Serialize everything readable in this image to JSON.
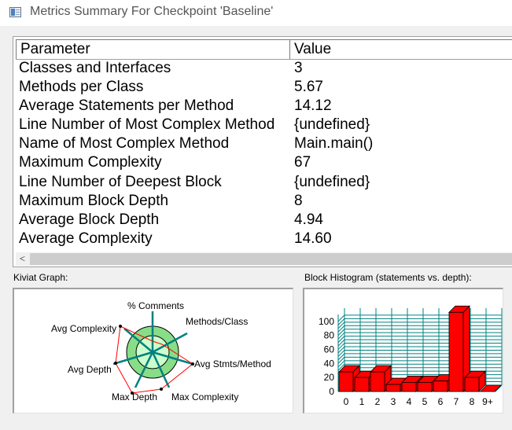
{
  "window": {
    "title": "Metrics Summary For Checkpoint 'Baseline'"
  },
  "table": {
    "headers": {
      "parameter": "Parameter",
      "value": "Value"
    },
    "rows": [
      {
        "parameter": "Classes and Interfaces",
        "value": "3"
      },
      {
        "parameter": "Methods per Class",
        "value": "5.67"
      },
      {
        "parameter": "Average Statements per Method",
        "value": "14.12"
      },
      {
        "parameter": "Line Number of Most Complex Method",
        "value": "{undefined}"
      },
      {
        "parameter": "Name of Most Complex Method",
        "value": "Main.main()"
      },
      {
        "parameter": "Maximum Complexity",
        "value": "67"
      },
      {
        "parameter": "Line Number of Deepest Block",
        "value": "{undefined}"
      },
      {
        "parameter": "Maximum Block Depth",
        "value": "8"
      },
      {
        "parameter": "Average Block Depth",
        "value": "4.94"
      },
      {
        "parameter": "Average Complexity",
        "value": "14.60"
      }
    ]
  },
  "scrollbar": {
    "left_arrow": "<"
  },
  "kiviat": {
    "label": "Kiviat Graph:",
    "axes": {
      "comments": "% Comments",
      "methods_class": "Methods/Class",
      "avg_stmts": "Avg Stmts/Method",
      "max_complexity": "Max Complexity",
      "max_depth": "Max Depth",
      "avg_depth": "Avg Depth",
      "avg_complexity": "Avg Complexity"
    }
  },
  "histogram": {
    "label": "Block Histogram (statements vs. depth):",
    "bar_color": "#ff0000",
    "grid_color": "#008080"
  },
  "chart_data": {
    "type": "bar",
    "categories": [
      "0",
      "1",
      "2",
      "3",
      "4",
      "5",
      "6",
      "7",
      "8",
      "9+"
    ],
    "values": [
      28,
      20,
      28,
      10,
      13,
      13,
      15,
      113,
      20,
      0
    ],
    "ylim": [
      0,
      110
    ],
    "yticks": [
      "100",
      "80",
      "60",
      "40",
      "20",
      "0"
    ],
    "grid": true
  }
}
